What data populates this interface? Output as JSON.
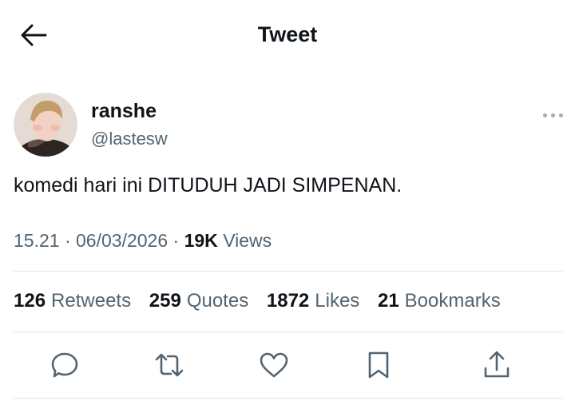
{
  "header": {
    "title": "Tweet",
    "back_icon": "arrow-left-icon"
  },
  "tweet": {
    "author": {
      "name": "ranshe",
      "handle": "@lastesw"
    },
    "text": "komedi hari ini DITUDUH JADI SIMPENAN.",
    "time": "15.21",
    "separator": "·",
    "date": "06/03/2026",
    "views_count": "19K",
    "views_label": "Views"
  },
  "stats": [
    {
      "count": "126",
      "label": "Retweets"
    },
    {
      "count": "259",
      "label": "Quotes"
    },
    {
      "count": "1872",
      "label": "Likes"
    },
    {
      "count": "21",
      "label": "Bookmarks"
    }
  ],
  "actions": [
    "reply-icon",
    "retweet-icon",
    "like-icon",
    "bookmark-icon",
    "share-icon"
  ],
  "colors": {
    "text": "#0f1419",
    "secondary": "#536471",
    "icon": "#536471",
    "divider": "#e1e4e6"
  }
}
